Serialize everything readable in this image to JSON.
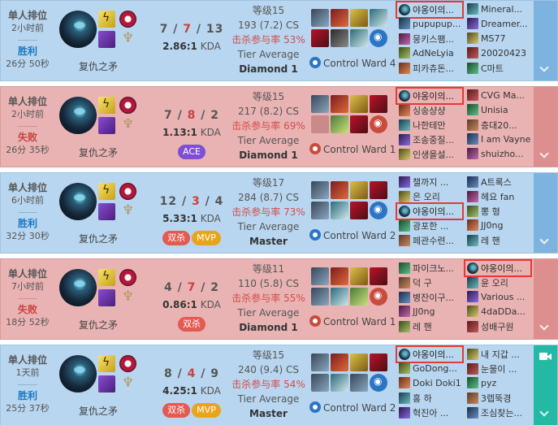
{
  "matches": [
    {
      "result_class": "win",
      "queue": "单人排位",
      "time_ago": "2小时前",
      "result": "胜利",
      "duration": "26分 50秒",
      "champion": "复仇之矛",
      "kills": "7",
      "deaths": "7",
      "assists": "13",
      "kda_ratio": "2.86:1",
      "kda_suffix": "KDA",
      "badges": [],
      "level": "等级15",
      "cs": "193 (7.2) CS",
      "kill_participation": "击杀参与率 53%",
      "tier_label": "Tier Average",
      "tier": "Diamond 1",
      "ward": "Control Ward 4",
      "toggle_icon": "chevron-down-icon",
      "team1": [
        "야옹이의...",
        "pupupup...",
        "뭉키스팸...",
        "AdNeLyia",
        "피카츄돈..."
      ],
      "team2": [
        "Mineral...",
        "Dreamer...",
        "MS77",
        "20020423",
        "C마트"
      ],
      "me_team": 1,
      "me_index": 0
    },
    {
      "result_class": "loss",
      "queue": "单人排位",
      "time_ago": "2小时前",
      "result": "失败",
      "duration": "26分 35秒",
      "champion": "复仇之矛",
      "kills": "7",
      "deaths": "8",
      "assists": "2",
      "kda_ratio": "1.13:1",
      "kda_suffix": "KDA",
      "badges": [
        {
          "text": "ACE",
          "color": "#7f4fd3"
        }
      ],
      "level": "等级15",
      "cs": "217 (8.2) CS",
      "kill_participation": "击杀参与率 69%",
      "tier_label": "Tier Average",
      "tier": "Diamond 1",
      "ward": "Control Ward 1",
      "toggle_icon": "chevron-down-icon",
      "team1": [
        "야옹이의...",
        "싱송샹샹",
        "나한테만",
        "조송중질...",
        "인생을설..."
      ],
      "team2": [
        "CVG Ma...",
        "Unisia",
        "충대20...",
        "I am Vayne",
        "shuizho..."
      ],
      "me_team": 1,
      "me_index": 0
    },
    {
      "result_class": "win",
      "queue": "单人排位",
      "time_ago": "6小时前",
      "result": "胜利",
      "duration": "32分 30秒",
      "champion": "复仇之矛",
      "kills": "12",
      "deaths": "3",
      "assists": "4",
      "kda_ratio": "5.33:1",
      "kda_suffix": "KDA",
      "badges": [
        {
          "text": "双杀",
          "color": "#e35a51"
        },
        {
          "text": "MVP",
          "color": "#e8a51b"
        }
      ],
      "level": "等级17",
      "cs": "284 (8.7) CS",
      "kill_participation": "击杀参与率 73%",
      "tier_label": "Tier Average",
      "tier": "Master",
      "ward": "Control Ward 2",
      "toggle_icon": "chevron-down-icon",
      "team1": [
        "챌까지 ...",
        "은 오리",
        "야옹이의...",
        "광포한 ...",
        "페관수련..."
      ],
      "team2": [
        "A트록스",
        "헤요 fan",
        "뽕 형",
        "JJ0ng",
        "레 핸"
      ],
      "me_team": 1,
      "me_index": 2
    },
    {
      "result_class": "loss",
      "queue": "单人排位",
      "time_ago": "7小时前",
      "result": "失败",
      "duration": "18分 52秒",
      "champion": "复仇之矛",
      "kills": "4",
      "deaths": "7",
      "assists": "2",
      "kda_ratio": "0.86:1",
      "kda_suffix": "KDA",
      "badges": [
        {
          "text": "双杀",
          "color": "#e35a51"
        }
      ],
      "level": "等级11",
      "cs": "110 (5.8) CS",
      "kill_participation": "击杀参与率 55%",
      "tier_label": "Tier Average",
      "tier": "Diamond 1",
      "ward": "Control Ward 1",
      "toggle_icon": "chevron-down-icon",
      "team1": [
        "파이크노...",
        "덕 구",
        "병잔이구...",
        "JJ0ng",
        "레 핸"
      ],
      "team2": [
        "야옹이의...",
        "윤 오리",
        "Various ...",
        "4daDDa...",
        "성배구원"
      ],
      "me_team": 2,
      "me_index": 0
    },
    {
      "result_class": "win",
      "queue": "单人排位",
      "time_ago": "1天前",
      "result": "胜利",
      "duration": "25分 37秒",
      "champion": "复仇之矛",
      "kills": "8",
      "deaths": "4",
      "assists": "9",
      "kda_ratio": "4.25:1",
      "kda_suffix": "KDA",
      "badges": [
        {
          "text": "双杀",
          "color": "#e35a51"
        },
        {
          "text": "MVP",
          "color": "#e8a51b"
        }
      ],
      "level": "等级15",
      "cs": "240 (9.4) CS",
      "kill_participation": "击杀参与率 54%",
      "tier_label": "Tier Average",
      "tier": "Master",
      "ward": "Control Ward 2",
      "toggle_icon": "video-camera-icon",
      "team1": [
        "야옹이의...",
        "GoDong...",
        "Doki Doki1",
        "홍 하",
        "혁진아 ..."
      ],
      "team2": [
        "내 지갑 ...",
        "눈물이 ...",
        "pyz",
        "3렙뚝경",
        "조심찾는..."
      ],
      "me_team": 1,
      "me_index": 0
    }
  ]
}
